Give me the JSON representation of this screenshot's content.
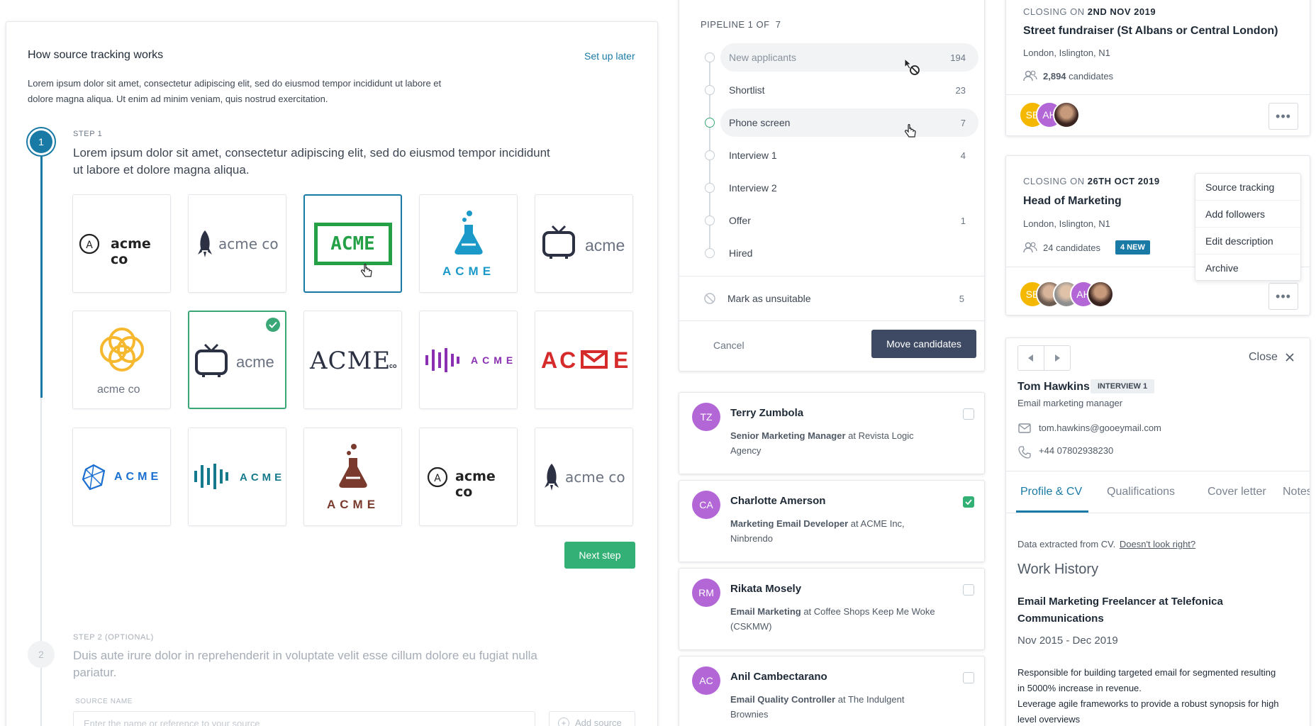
{
  "source_tracking": {
    "title": "How source tracking works",
    "setup_later": "Set up later",
    "intro": "Lorem ipsum dolor sit amet, consectetur adipiscing elit, sed do eiusmod tempor incididunt ut labore et dolore magna aliqua. Ut enim ad minim veniam, quis nostrud exercitation.",
    "intro_line1": "Lorem ipsum dolor sit amet, consectetur adipiscing elit, sed do eiusmod tempor incididunt ut labore et",
    "intro_line2": "dolore magna aliqua. Ut enim ad minim veniam, quis nostrud exercitation.",
    "step1": {
      "number": "1",
      "label": "STEP 1",
      "text_line1": "Lorem ipsum dolor sit amet, consectetur adipiscing elit, sed do eiusmod tempor incididunt",
      "text_line2": "ut labore et dolore magna aliqua."
    },
    "logos": {
      "l1": "acme co",
      "l2": "acme co",
      "l3": "ACME",
      "l4": "ACME",
      "l5": "acme",
      "l6": "acme co",
      "l7": "acme",
      "l8": "ACME",
      "l8_sup": "co",
      "l9": "ACME",
      "l10_a": "AC",
      "l10_b": "E",
      "l11": "ACME",
      "l12": "ACME",
      "l13": "ACME",
      "l14": "acme co",
      "l15": "acme co"
    },
    "next_step": "Next step",
    "step2": {
      "number": "2",
      "label": "STEP 2 (OPTIONAL)",
      "text_line1": "Duis aute irure dolor in reprehenderit in voluptate velit esse cillum dolore eu fugiat nulla",
      "text_line2": "pariatur.",
      "source_name_label": "SOURCE NAME",
      "source_name_placeholder": "Enter the name or reference to your source",
      "add_source": "Add source"
    }
  },
  "pipeline": {
    "header": "PIPELINE 1 OF  7",
    "stages": [
      {
        "name": "New applicants",
        "count": "194"
      },
      {
        "name": "Shortlist",
        "count": "23"
      },
      {
        "name": "Phone screen",
        "count": "7"
      },
      {
        "name": "Interview 1",
        "count": "4"
      },
      {
        "name": "Interview 2",
        "count": ""
      },
      {
        "name": "Offer",
        "count": "1"
      },
      {
        "name": "Hired",
        "count": ""
      }
    ],
    "unsuitable": {
      "name": "Mark as unsuitable",
      "count": "5"
    },
    "cancel": "Cancel",
    "move": "Move candidates"
  },
  "candidates": [
    {
      "initials": "TZ",
      "name": "Terry Zumbola",
      "role": "Senior Marketing Manager",
      "at": "at",
      "company": "Revista Logic",
      "company2": "Agency",
      "checked": false
    },
    {
      "initials": "CA",
      "name": "Charlotte Amerson",
      "role": "Marketing Email Developer",
      "at": "at",
      "company": "ACME Inc,",
      "company2": "Ninbrendo",
      "checked": true
    },
    {
      "initials": "RM",
      "name": "Rikata Mosely",
      "role": "Email Marketing",
      "at": "at",
      "company": "Coffee Shops Keep Me Woke",
      "company2": "(CSKMW)",
      "checked": false
    },
    {
      "initials": "AC",
      "name": "Anil Cambectarano",
      "role": "Email Quality Controller",
      "at": "at",
      "company": "The Indulgent",
      "company2": "Brownies",
      "checked": false
    }
  ],
  "jobs": [
    {
      "closing_prefix": "CLOSING ON",
      "closing_date": "2ND NOV 2019",
      "title": "Street fundraiser (St Albans or Central London)",
      "location": "London, Islington, N1",
      "candidates": "2,894",
      "candidates_suffix": "candidates",
      "avatars": [
        "SB",
        "AH",
        ""
      ]
    },
    {
      "closing_prefix": "CLOSING ON",
      "closing_date": "26TH OCT 2019",
      "title": "Head of Marketing",
      "location": "London, Islington, N1",
      "candidates": "24 candidates",
      "badge": "4 NEW",
      "avatars": [
        "SB",
        "",
        "",
        "AH",
        ""
      ]
    }
  ],
  "job_menu": [
    "Source tracking",
    "Add followers",
    "Edit description",
    "Archive"
  ],
  "profile": {
    "close": "Close",
    "name": "Tom Hawkins",
    "stage_badge": "INTERVIEW 1",
    "title": "Email marketing manager",
    "email": "tom.hawkins@gooeymail.com",
    "phone": "+44 07802938230",
    "tabs": [
      "Profile & CV",
      "Qualifications",
      "Cover letter",
      "Notes & ac"
    ],
    "extracted": "Data extracted from CV.",
    "extracted_link": "Doesn't look right?",
    "work_history": "Work History",
    "job_title_line1": "Email Marketing Freelancer at Telefonica",
    "job_title_line2": "Communications",
    "dates": "Nov 2015 - Dec 2019",
    "desc_line1": "Responsible for building targeted email for segmented resulting",
    "desc_line2": "in 5000% increase in revenue.",
    "desc_line3": "Leverage agile frameworks to provide a robust synopsis for high",
    "desc_line4": "level overviews"
  },
  "colors": {
    "accent": "#1a7aa6",
    "green": "#33b075",
    "navy": "#3e4a63",
    "purple": "#b366d6",
    "badge_teal": "#1a7aa6"
  }
}
